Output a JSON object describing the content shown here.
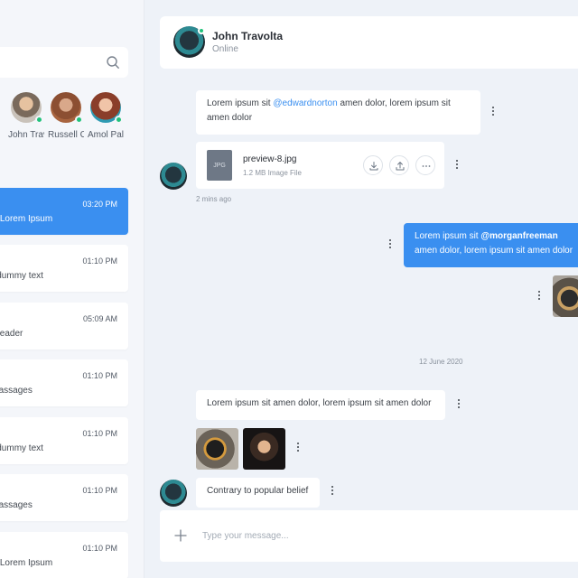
{
  "search": {
    "placeholder": ""
  },
  "stories": [
    {
      "name": "John Travolta"
    },
    {
      "name": "Russell Crowe"
    },
    {
      "name": "Amol Palekar"
    }
  ],
  "conversations": [
    {
      "time": "03:20 PM",
      "preview": "Contrary to popular belief, Lorem Ipsum",
      "active": true
    },
    {
      "time": "01:10 PM",
      "preview": "Lorem Ipsum is simply dummy text",
      "active": false
    },
    {
      "time": "05:09 AM",
      "preview": "It is a long established fact that a reader",
      "active": false
    },
    {
      "time": "01:10 PM",
      "preview": "There are many variations of passages",
      "active": false
    },
    {
      "time": "01:10 PM",
      "preview": "Lorem Ipsum is simply dummy text",
      "active": false
    },
    {
      "time": "01:10 PM",
      "preview": "There are many variations of passages",
      "active": false
    },
    {
      "time": "01:10 PM",
      "preview": "Contrary to popular belief, Lorem Ipsum",
      "active": false
    }
  ],
  "header": {
    "name": "John Travolta",
    "status": "Online"
  },
  "messages": {
    "m1": {
      "pre": "Lorem ipsum sit ",
      "mention": "@edwardnorton",
      "post": " amen dolor, lorem ipsum sit amen dolor"
    },
    "file": {
      "name": "preview-8.jpg",
      "size": "1.2 MB Image File",
      "badge": "JPG"
    },
    "time1": "2 mins ago",
    "m2": {
      "pre": "Lorem ipsum sit ",
      "mention": "@morganfreeman",
      "post": " amen dolor, lorem ipsum sit amen dolor"
    },
    "date": "12 June 2020",
    "m3": "Lorem ipsum sit amen dolor, lorem ipsum sit amen dolor",
    "m4": "Contrary to popular belief"
  },
  "composer": {
    "placeholder": "Type your message..."
  },
  "colors": {
    "accent": "#3a8ff0",
    "online": "#21c27b",
    "background": "#eef2f8"
  },
  "icons": {
    "search": "search-icon",
    "download": "download-icon",
    "share": "share-icon",
    "more": "more-icon",
    "plus": "plus-icon"
  }
}
